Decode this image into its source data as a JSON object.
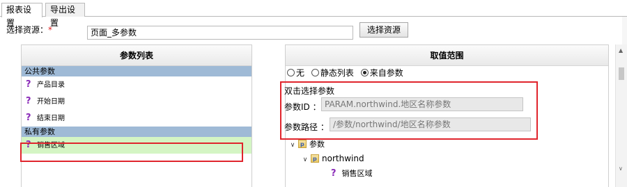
{
  "tabs": [
    {
      "label": "报表设置",
      "active": true
    },
    {
      "label": "导出设置",
      "active": false
    }
  ],
  "source": {
    "label": "选择资源：",
    "required_mark": "*",
    "value": "页面_多参数",
    "button_label": "选择资源"
  },
  "param_list": {
    "title": "参数列表",
    "public_group": "公共参数",
    "public_params": [
      "产品目录",
      "开始日期",
      "结束日期"
    ],
    "private_group": "私有参数",
    "private_params": [
      "销售区域"
    ],
    "icon": "question-mark-icon"
  },
  "value_range": {
    "title": "取值范围",
    "options": [
      {
        "label": "无",
        "checked": false
      },
      {
        "label": "静态列表",
        "checked": false
      },
      {
        "label": "来自参数",
        "checked": true
      }
    ],
    "pick_title": "双击选择参数",
    "param_id_label": "参数ID ：",
    "param_id_value": "PARAM.northwind.地区名称参数",
    "param_path_label": "参数路径 ：",
    "param_path_value": "/参数/northwind/地区名称参数",
    "tree": {
      "root": "参数",
      "child": "northwind",
      "leaf": "销售区域"
    }
  },
  "colors": {
    "selected_row": "#d4f5c4",
    "group_header": "#9fbad6",
    "highlight_frame": "#e0242c",
    "param_icon": "#8a2bb8"
  }
}
